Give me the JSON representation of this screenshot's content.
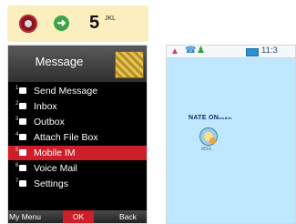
{
  "keys": {
    "end_icon": "end-call-icon",
    "send_icon": "send-icon",
    "five_label": "5",
    "five_sub_label": "JKL"
  },
  "left_screen": {
    "title": "Message",
    "menu_items": [
      {
        "label": "Send Message",
        "icon": "send-message-icon"
      },
      {
        "label": "Inbox",
        "icon": "inbox-icon"
      },
      {
        "label": "Outbox",
        "icon": "outbox-icon"
      },
      {
        "label": "Attach File Box",
        "icon": "attach-file-icon"
      },
      {
        "label": "Mobile IM",
        "icon": "mobile-im-icon",
        "selected": true
      },
      {
        "label": "Voice Mail",
        "icon": "voice-mail-icon"
      },
      {
        "label": "Settings",
        "icon": "settings-icon"
      }
    ],
    "softkeys": {
      "left": "My Menu",
      "center": "OK",
      "right": "Back"
    }
  },
  "right_screen": {
    "status_time": "11:3",
    "logo_main": "NATE ON",
    "logo_sub": "mobile",
    "caption": "MSG",
    "accent_color": "#cc1f2a"
  }
}
